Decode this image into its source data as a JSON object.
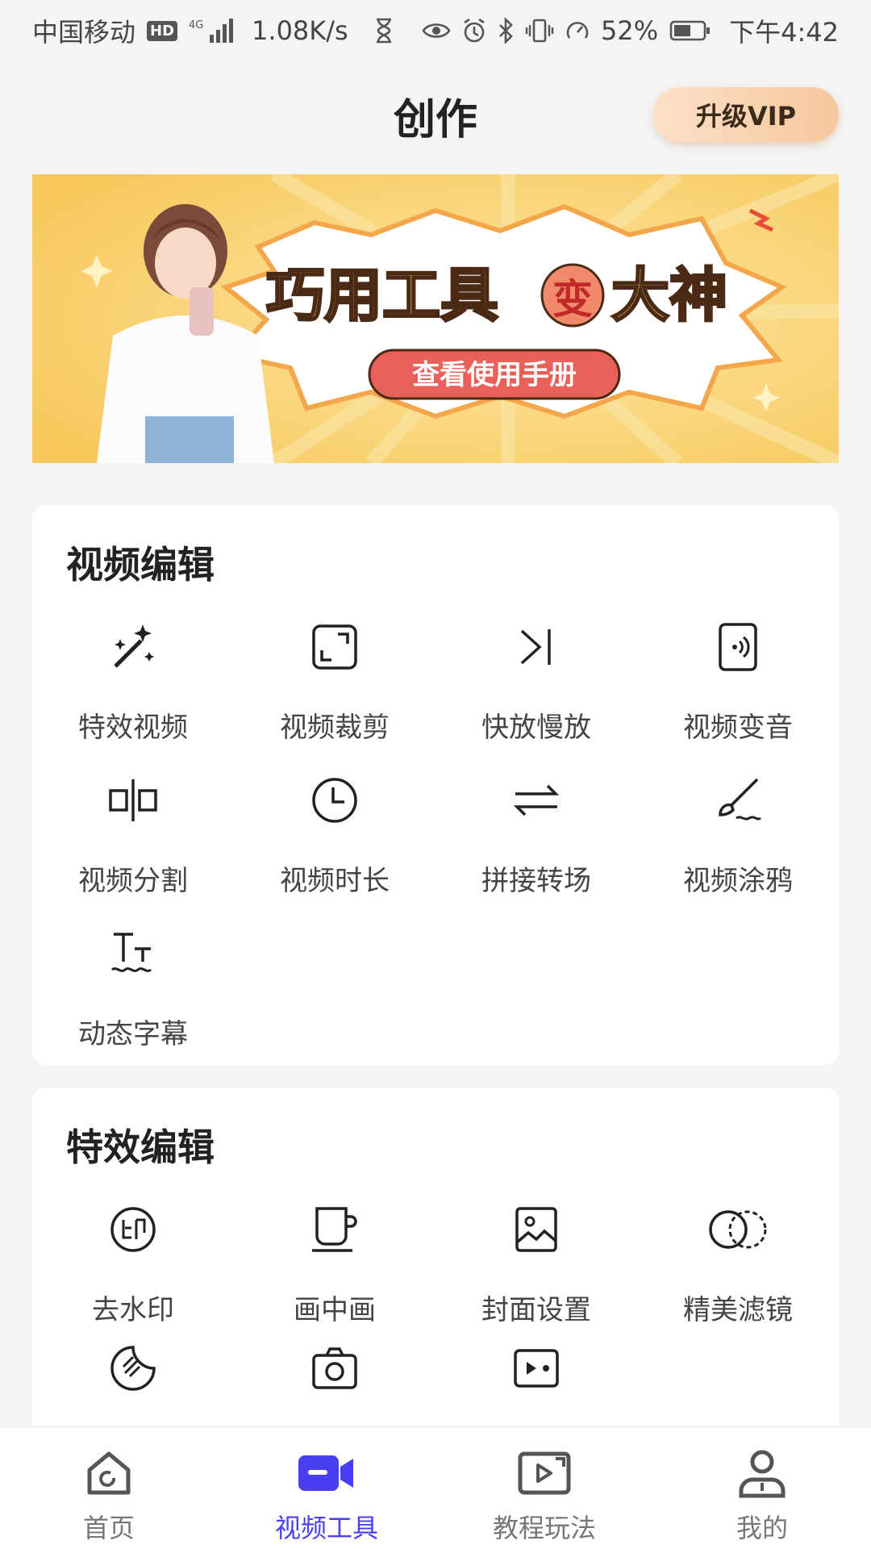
{
  "status_bar": {
    "carrier": "中国移动",
    "hd": "HD",
    "net_type": "4G",
    "speed": "1.08K/s",
    "battery": "52%",
    "time": "下午4:42"
  },
  "header": {
    "title": "创作",
    "vip_button": "升级VIP"
  },
  "banner": {
    "headline": "巧用工具变大神",
    "headline_left": "巧用工具",
    "headline_badge": "变",
    "headline_right": "大神",
    "button": "查看使用手册"
  },
  "sections": [
    {
      "title": "视频编辑",
      "tools": [
        {
          "label": "特效视频",
          "icon": "magic-wand-icon"
        },
        {
          "label": "视频裁剪",
          "icon": "crop-frame-icon"
        },
        {
          "label": "快放慢放",
          "icon": "fast-forward-icon"
        },
        {
          "label": "视频变音",
          "icon": "voice-change-icon"
        },
        {
          "label": "视频分割",
          "icon": "split-icon"
        },
        {
          "label": "视频时长",
          "icon": "clock-icon"
        },
        {
          "label": "拼接转场",
          "icon": "transition-arrows-icon"
        },
        {
          "label": "视频涂鸦",
          "icon": "paint-brush-icon"
        },
        {
          "label": "动态字幕",
          "icon": "text-subtitle-icon"
        }
      ]
    },
    {
      "title": "特效编辑",
      "tools": [
        {
          "label": "去水印",
          "icon": "watermark-stamp-icon"
        },
        {
          "label": "画中画",
          "icon": "picture-in-picture-icon"
        },
        {
          "label": "封面设置",
          "icon": "cover-image-icon"
        },
        {
          "label": "精美滤镜",
          "icon": "filter-circles-icon"
        },
        {
          "label": "",
          "icon": "sticker-icon"
        },
        {
          "label": "",
          "icon": "camera-icon"
        },
        {
          "label": "",
          "icon": "video-player-icon"
        }
      ]
    }
  ],
  "tabbar": {
    "tabs": [
      {
        "label": "首页",
        "icon": "home-icon"
      },
      {
        "label": "视频工具",
        "icon": "video-camera-icon",
        "active": true
      },
      {
        "label": "教程玩法",
        "icon": "tutorial-play-icon"
      },
      {
        "label": "我的",
        "icon": "profile-icon"
      }
    ]
  },
  "colors": {
    "accent": "#4a3ff0",
    "banner_bg": "#f8cf6d",
    "banner_button": "#e8605a",
    "vip_gradient_start": "#fde0c8",
    "vip_gradient_end": "#f6c79d"
  }
}
